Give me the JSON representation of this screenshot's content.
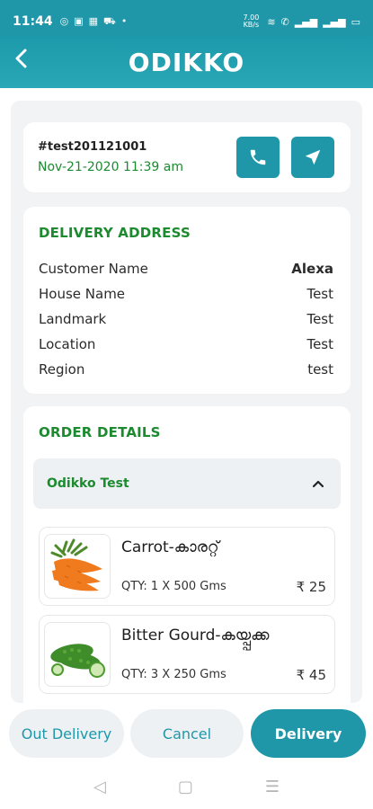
{
  "status_bar": {
    "time": "11:44",
    "left_icons": [
      "whatsapp-icon",
      "image-icon",
      "messenger-icon",
      "cart-icon",
      "dot-icon"
    ],
    "right_icons": [
      "data-speed-icon",
      "wifi-icon",
      "volte-icon",
      "signal-icon",
      "signal-icon",
      "battery-icon"
    ],
    "speed_text": "7.00 KB/s"
  },
  "header": {
    "back_icon": "back-arrow-icon",
    "logo_text": "ODIKKO"
  },
  "order": {
    "id": "#test201121001",
    "date": "Nov-21-2020 11:39 am",
    "call_icon": "phone-icon",
    "navigate_icon": "navigation-arrow-icon"
  },
  "address": {
    "title": "DELIVERY ADDRESS",
    "rows": [
      {
        "label": "Customer Name",
        "value": "Alexa"
      },
      {
        "label": "House Name",
        "value": "Test"
      },
      {
        "label": "Landmark",
        "value": "Test"
      },
      {
        "label": "Location",
        "value": "Test"
      },
      {
        "label": "Region",
        "value": "test"
      }
    ]
  },
  "details": {
    "title": "ORDER DETAILS",
    "store_name": "Odikko Test",
    "items": [
      {
        "name": "Carrot-കാരറ്റ്",
        "qty": "QTY: 1 X 500 Gms",
        "price": "₹ 25"
      },
      {
        "name": "Bitter Gourd-കയ്പ്പക്ക",
        "qty": "QTY: 3 X 250 Gms",
        "price": "₹ 45"
      }
    ]
  },
  "actions": {
    "out_delivery": "Out Delivery",
    "cancel": "Cancel",
    "delivery": "Delivery"
  },
  "colors": {
    "primary": "#1f97a8",
    "accent_green": "#1c8a2f",
    "panel_bg": "#f1f3f4"
  }
}
